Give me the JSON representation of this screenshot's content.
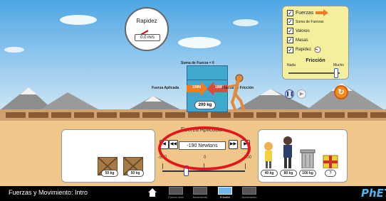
{
  "speedometer": {
    "title": "Rapidez",
    "readout": "0.0 m/s"
  },
  "controls": {
    "items": [
      {
        "label": "Fuerzas",
        "checked": true
      },
      {
        "label": "Suma de Fuerzas",
        "checked": true
      },
      {
        "label": "Valores",
        "checked": true
      },
      {
        "label": "Masas",
        "checked": true
      },
      {
        "label": "Rapidez",
        "checked": true
      }
    ],
    "friccion_title": "Fricción",
    "nada_label": "Nada",
    "mucho_label": "Mucho",
    "friccion_level": 1.0
  },
  "scene": {
    "sum_of_forces_label": "Suma de Fuerza = 0",
    "applied_force_label": "Fuerza Aplicada",
    "applied_force_value": "190N",
    "friction_force_value": "190N",
    "friction_force_label": "Fuerza de Fricción",
    "object_mass": "200 kg"
  },
  "applied_force": {
    "title": "Fuerza Aplicada",
    "value": "-190 Newtons",
    "slider_min": "-500",
    "slider_zero": "0",
    "slider_max": "500",
    "slider_value": -190
  },
  "left_masses": [
    "50 kg",
    "50 kg"
  ],
  "right_masses": [
    "40 kg",
    "80 kg",
    "100 kg",
    "?"
  ],
  "bottom_bar": {
    "app_title": "Fuerzas y Movimiento: Intro",
    "screens": [
      "Fuerza neta",
      "Movimiento",
      "Fricción",
      "Aceleración"
    ],
    "selected_screen": "Fricción",
    "logo": "PhET"
  },
  "colors": {
    "applied_arrow": "#f07c22",
    "friction_arrow": "#d84c3a",
    "panel_bg": "#f3ef9c",
    "highlight_ellipse": "#e2161c"
  }
}
